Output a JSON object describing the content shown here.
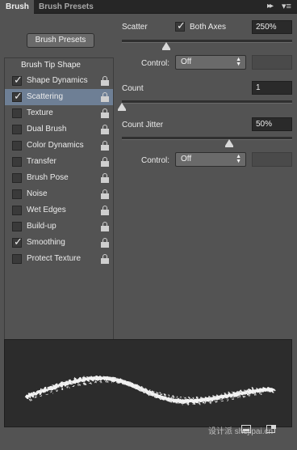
{
  "tabs": [
    {
      "label": "Brush",
      "active": true
    },
    {
      "label": "Brush Presets",
      "active": false
    }
  ],
  "presets_button": "Brush Presets",
  "list": {
    "header": "Brush Tip Shape",
    "items": [
      {
        "label": "Shape Dynamics",
        "checked": true,
        "selected": false
      },
      {
        "label": "Scattering",
        "checked": true,
        "selected": true
      },
      {
        "label": "Texture",
        "checked": false,
        "selected": false
      },
      {
        "label": "Dual Brush",
        "checked": false,
        "selected": false
      },
      {
        "label": "Color Dynamics",
        "checked": false,
        "selected": false
      },
      {
        "label": "Transfer",
        "checked": false,
        "selected": false
      },
      {
        "label": "Brush Pose",
        "checked": false,
        "selected": false
      },
      {
        "label": "Noise",
        "checked": false,
        "selected": false
      },
      {
        "label": "Wet Edges",
        "checked": false,
        "selected": false
      },
      {
        "label": "Build-up",
        "checked": false,
        "selected": false
      },
      {
        "label": "Smoothing",
        "checked": true,
        "selected": false
      },
      {
        "label": "Protect Texture",
        "checked": false,
        "selected": false
      }
    ]
  },
  "scatter": {
    "label": "Scatter",
    "both_axes_label": "Both Axes",
    "both_axes_checked": true,
    "value": "250%",
    "slider_fraction": 0.26,
    "control_label": "Control:",
    "control_value": "Off"
  },
  "count": {
    "label": "Count",
    "value": "1",
    "slider_fraction": 0.0
  },
  "count_jitter": {
    "label": "Count Jitter",
    "value": "50%",
    "slider_fraction": 0.63,
    "control_label": "Control:",
    "control_value": "Off"
  },
  "watermark": "设计派 shejipai.cn",
  "colors": {
    "panel": "#535353",
    "selection": "#6e7f95",
    "field": "#2a2a2a"
  }
}
